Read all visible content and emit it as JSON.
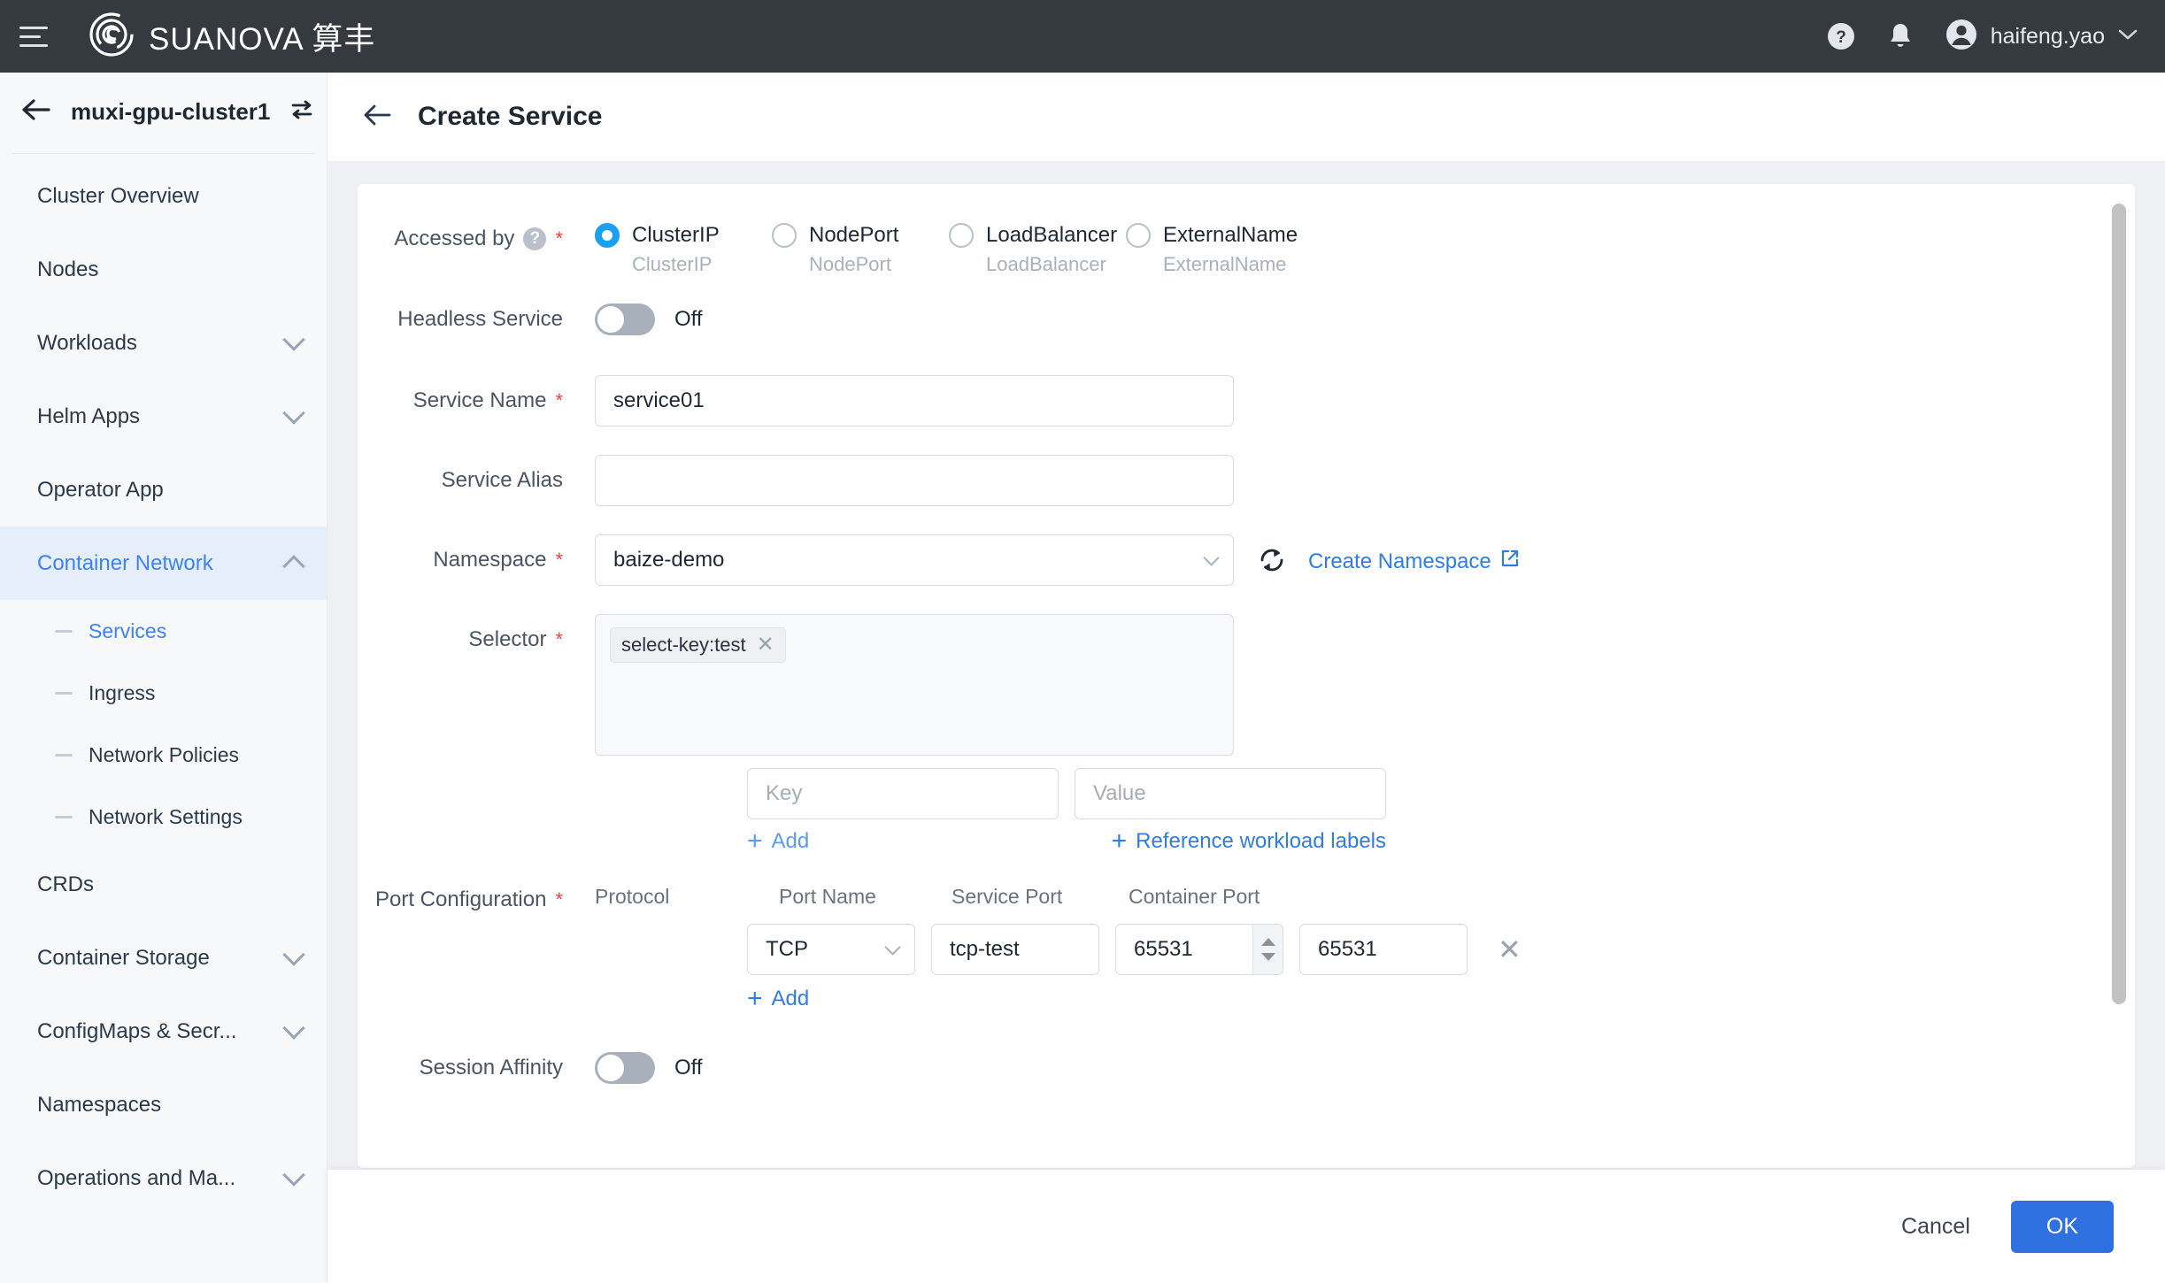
{
  "topbar": {
    "brand": "SUANOVA 算丰",
    "help_icon": "help-circle-icon",
    "bell_icon": "bell-icon",
    "user": "haifeng.yao"
  },
  "sidebar": {
    "cluster_name": "muxi-gpu-cluster1",
    "items": [
      {
        "label": "Cluster Overview",
        "expandable": false
      },
      {
        "label": "Nodes",
        "expandable": false
      },
      {
        "label": "Workloads",
        "expandable": true
      },
      {
        "label": "Helm Apps",
        "expandable": true
      },
      {
        "label": "Operator App",
        "expandable": false
      },
      {
        "label": "Container Network",
        "expandable": true,
        "active": true
      },
      {
        "label": "CRDs",
        "expandable": false
      },
      {
        "label": "Container Storage",
        "expandable": true
      },
      {
        "label": "ConfigMaps & Secr...",
        "expandable": true
      },
      {
        "label": "Namespaces",
        "expandable": false
      },
      {
        "label": "Operations and Ma...",
        "expandable": true
      }
    ],
    "sub_items": [
      {
        "label": "Services",
        "active": true
      },
      {
        "label": "Ingress",
        "active": false
      },
      {
        "label": "Network Policies",
        "active": false
      },
      {
        "label": "Network Settings",
        "active": false
      }
    ]
  },
  "page": {
    "title": "Create Service"
  },
  "form": {
    "accessed_by": {
      "label": "Accessed by",
      "required": true,
      "options": [
        {
          "label": "ClusterIP",
          "sub": "ClusterIP",
          "selected": true
        },
        {
          "label": "NodePort",
          "sub": "NodePort",
          "selected": false
        },
        {
          "label": "LoadBalancer",
          "sub": "LoadBalancer",
          "selected": false
        },
        {
          "label": "ExternalName",
          "sub": "ExternalName",
          "selected": false
        }
      ]
    },
    "headless_service": {
      "label": "Headless Service",
      "state": "Off",
      "on": false
    },
    "service_name": {
      "label": "Service Name",
      "required": true,
      "value": "service01"
    },
    "service_alias": {
      "label": "Service Alias",
      "required": false,
      "value": ""
    },
    "namespace": {
      "label": "Namespace",
      "required": true,
      "value": "baize-demo",
      "create_link": "Create Namespace"
    },
    "selector": {
      "label": "Selector",
      "required": true,
      "tags": [
        "select-key:test"
      ],
      "key_placeholder": "Key",
      "value_placeholder": "Value",
      "key_value": "",
      "value_value": "",
      "add_label": "Add",
      "reference_label": "Reference workload labels"
    },
    "port_configuration": {
      "label": "Port Configuration",
      "required": true,
      "headers": [
        "Protocol",
        "Port Name",
        "Service Port",
        "Container Port"
      ],
      "rows": [
        {
          "protocol": "TCP",
          "port_name": "tcp-test",
          "service_port": "65531",
          "container_port": "65531"
        }
      ],
      "add_label": "Add"
    },
    "session_affinity": {
      "label": "Session Affinity",
      "state": "Off",
      "on": false
    }
  },
  "footer": {
    "cancel_label": "Cancel",
    "ok_label": "OK"
  },
  "colors": {
    "accent": "#2f7ce5",
    "primary_button": "#2f71e0",
    "topbar_bg": "#343a40",
    "required": "#e8453c",
    "radio_selected": "#1aa0f0"
  }
}
